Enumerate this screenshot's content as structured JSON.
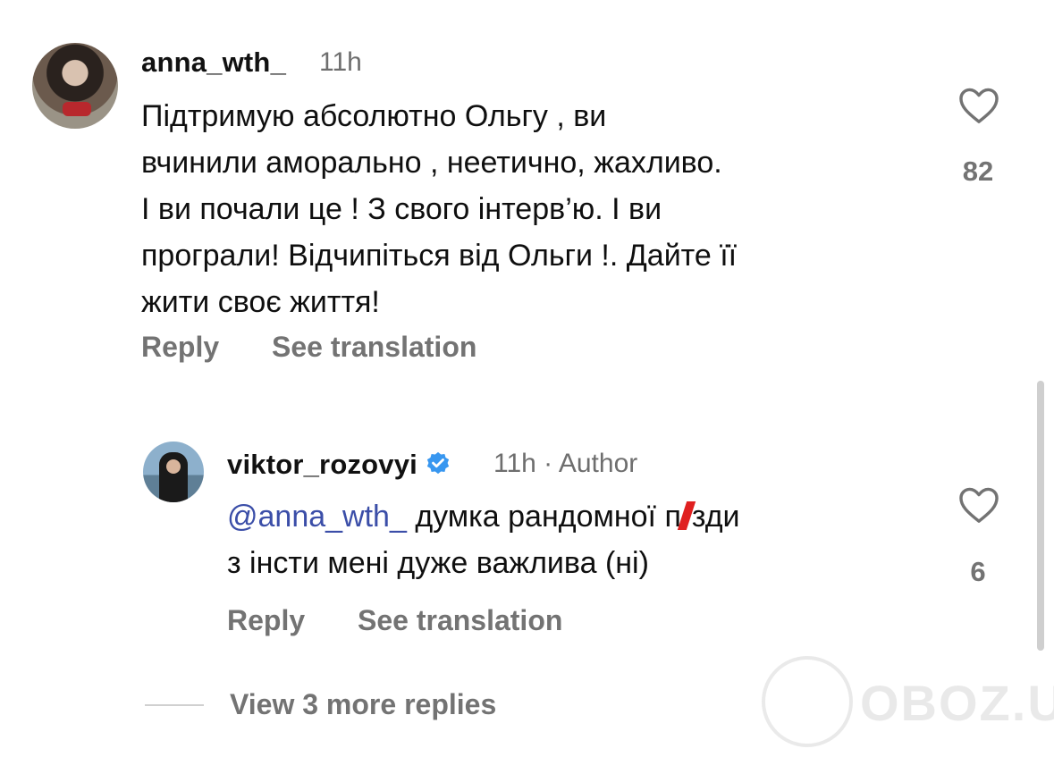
{
  "comment1": {
    "username": "anna_wth_",
    "time": "11h",
    "lines": [
      "Підтримую  абсолютно Ольгу , ви",
      "вчинили аморально , неетично, жахливо.",
      "І ви почали це ! З свого інтерв’ю. І ви",
      "програли! Відчипіться від Ольги !. Дайте її",
      "жити своє життя!"
    ],
    "reply_label": "Reply",
    "translate_label": "See translation",
    "likes": "82"
  },
  "comment2": {
    "username": "viktor_rozovyi",
    "time": "11h",
    "separator": "·",
    "author_badge": "Author",
    "mention": "@anna_wth_",
    "line1_a": " думка рандомної п",
    "line1_b": "зди",
    "line2": "з інсти мені дуже важлива (ні)",
    "reply_label": "Reply",
    "translate_label": "See translation",
    "likes": "6"
  },
  "view_more": "View 3 more replies",
  "watermark": "OBOZ.UA",
  "colors": {
    "mention": "#3b4ea8",
    "verified": "#3897f0",
    "gray": "#737373"
  },
  "icons": {
    "like": "heart-outline-icon",
    "verified": "verified-badge-icon"
  }
}
